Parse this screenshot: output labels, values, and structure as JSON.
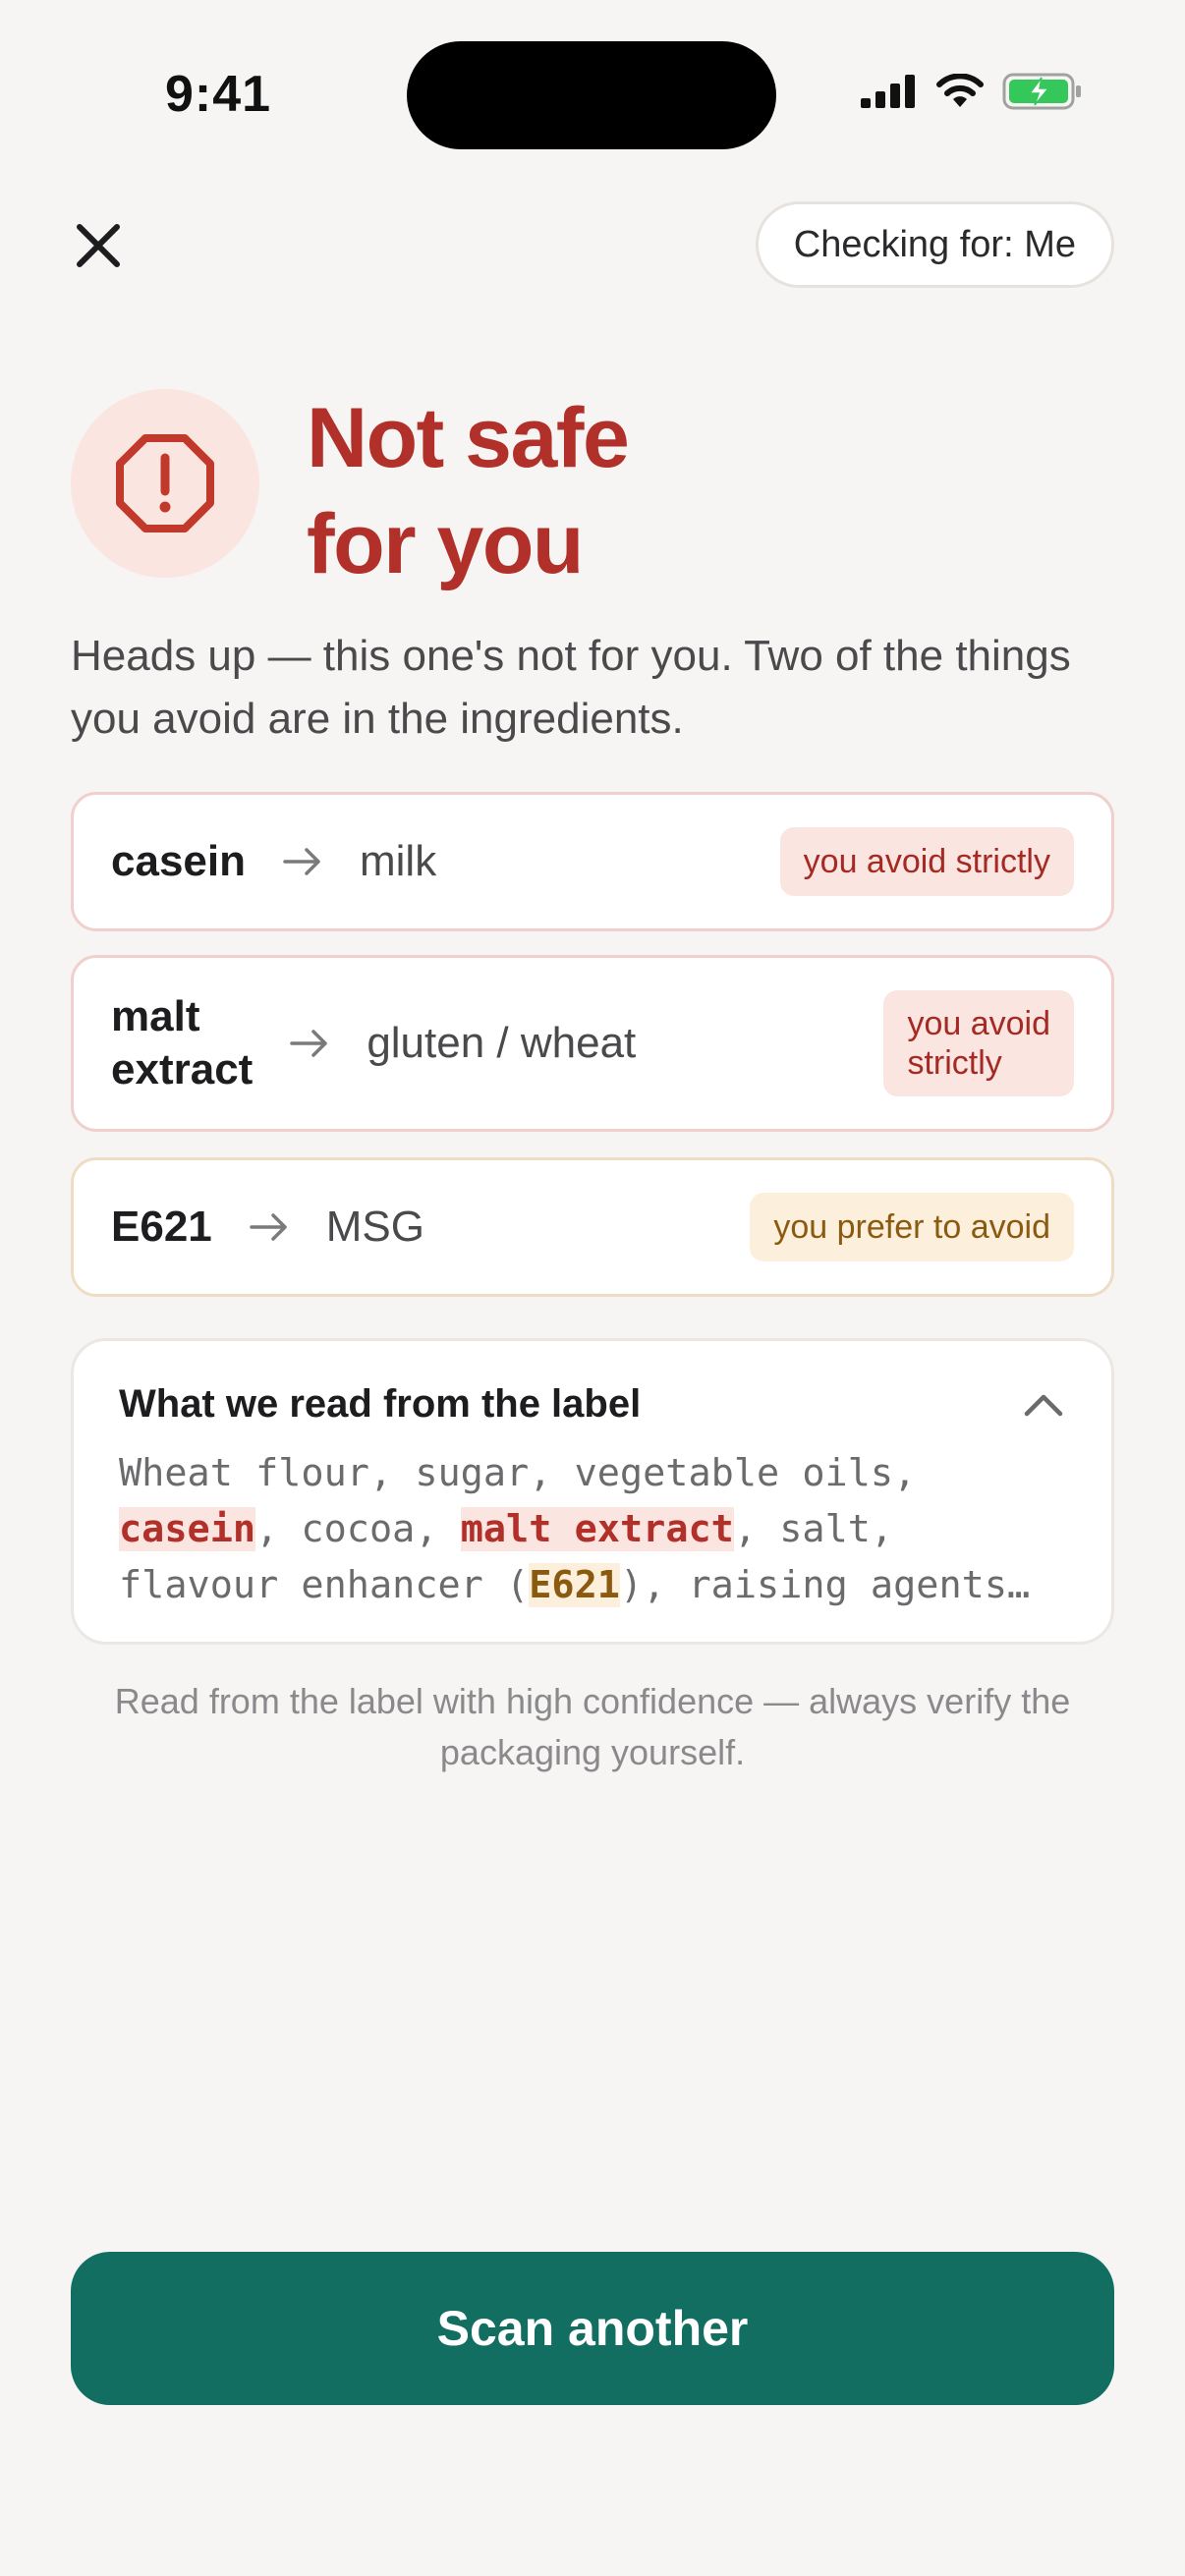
{
  "status_bar": {
    "time": "9:41"
  },
  "header": {
    "checking_for": "Checking for: Me"
  },
  "verdict": {
    "title_line1": "Not safe",
    "title_line2": "for you",
    "description": "Heads up — this one's not for you. Two of the things you avoid are in the ingredients.",
    "color": "#b2302a"
  },
  "matches": [
    {
      "ingredient": "casein",
      "maps_to": "milk",
      "badge": "you avoid strictly",
      "severity": "strict"
    },
    {
      "ingredient_line1": "malt",
      "ingredient_line2": "extract",
      "maps_to": "gluten / wheat",
      "badge_line1": "you avoid",
      "badge_line2": "strictly",
      "severity": "strict"
    },
    {
      "ingredient": "E621",
      "maps_to": "MSG",
      "badge": "you prefer to avoid",
      "severity": "prefer"
    }
  ],
  "label_panel": {
    "title": "What we read from the label",
    "parts": [
      "Wheat flour, sugar, vegetable oils,",
      "casein",
      ", cocoa, ",
      "malt extract",
      ", salt,",
      "flavour enhancer (",
      "E621",
      "), raising agents…"
    ]
  },
  "footnote": "Read from the label with high confidence — always verify the packaging yourself.",
  "primary_action": {
    "label": "Scan another",
    "color": "#126e61"
  }
}
